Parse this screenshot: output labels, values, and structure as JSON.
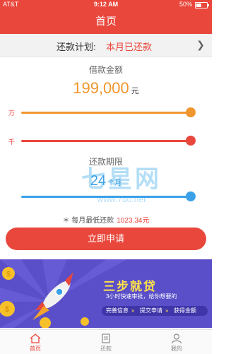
{
  "status_bar": {
    "carrier": "AT&T",
    "time": "9:12 AM",
    "battery_pct": "50%",
    "battery_level": 0.5
  },
  "nav": {
    "title": "首页"
  },
  "repay": {
    "label": "还款计划:",
    "value": "本月已还款"
  },
  "loan": {
    "amount_title": "借款金额",
    "amount": "199,000",
    "amount_unit": "元",
    "slider1_label": "万",
    "slider1_level": 1.0,
    "slider2_label": "千",
    "slider2_level": 1.0,
    "term_title": "还款期限",
    "term": "24",
    "term_unit": "个月",
    "term_level": 1.0,
    "monthly_label": "＊ 每月最低还款",
    "monthly_amount": "1023.34元"
  },
  "watermark": {
    "brand": "七星网",
    "url": "www.7do.net"
  },
  "apply_button": "立即申请",
  "banner": {
    "headline": "三步就贷",
    "subline": "3小时快速审批，给你想要的",
    "steps": [
      "完善信息",
      "提交申请",
      "获得金额"
    ]
  },
  "tabs": [
    {
      "label": "首页",
      "icon": "home-icon",
      "active": true
    },
    {
      "label": "还款",
      "icon": "clipboard-icon",
      "active": false
    },
    {
      "label": "我的",
      "icon": "user-icon",
      "active": false
    }
  ],
  "colors": {
    "accent": "#e9473c",
    "orange": "#f0962e",
    "blue": "#3aa0e8"
  }
}
